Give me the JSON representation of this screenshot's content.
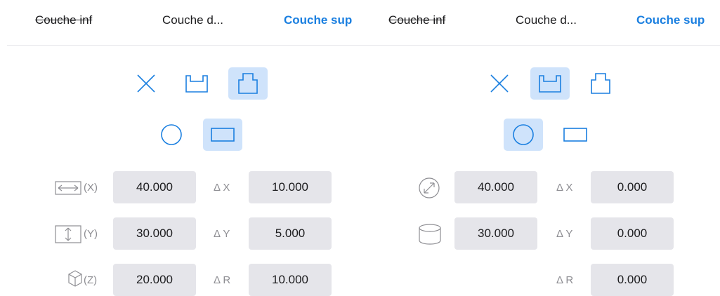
{
  "colors": {
    "accent": "#1a7fe0",
    "selected_bg": "#cfe3fb",
    "field_bg": "#e5e5ea",
    "muted": "#8e8e93"
  },
  "left": {
    "tabs": [
      {
        "label": "Couche inf",
        "state": "struck"
      },
      {
        "label": "Couche d...",
        "state": "normal"
      },
      {
        "label": "Couche sup",
        "state": "active"
      }
    ],
    "mode_buttons": [
      {
        "icon": "close-icon",
        "selected": false
      },
      {
        "icon": "pocket-down-icon",
        "selected": false
      },
      {
        "icon": "pocket-up-icon",
        "selected": true
      }
    ],
    "shape_buttons": [
      {
        "icon": "circle-icon",
        "selected": false
      },
      {
        "icon": "rectangle-icon",
        "selected": true
      }
    ],
    "rows": [
      {
        "icon": "width-icon",
        "axis": "(X)",
        "value": "40.000",
        "delta_label": "Δ X",
        "delta_value": "10.000"
      },
      {
        "icon": "height-icon",
        "axis": "(Y)",
        "value": "30.000",
        "delta_label": "Δ Y",
        "delta_value": "5.000"
      },
      {
        "icon": "depth-cube-icon",
        "axis": "(Z)",
        "value": "20.000",
        "delta_label": "Δ R",
        "delta_value": "10.000"
      }
    ]
  },
  "right": {
    "tabs": [
      {
        "label": "Couche inf",
        "state": "struck"
      },
      {
        "label": "Couche d...",
        "state": "normal"
      },
      {
        "label": "Couche sup",
        "state": "active"
      }
    ],
    "mode_buttons": [
      {
        "icon": "close-icon",
        "selected": false
      },
      {
        "icon": "pocket-down-icon",
        "selected": true
      },
      {
        "icon": "pocket-up-icon",
        "selected": false
      }
    ],
    "shape_buttons": [
      {
        "icon": "circle-icon",
        "selected": true
      },
      {
        "icon": "rectangle-icon",
        "selected": false
      }
    ],
    "rows": [
      {
        "icon": "diameter-icon",
        "value": "40.000",
        "delta_label": "Δ X",
        "delta_value": "0.000"
      },
      {
        "icon": "cylinder-icon",
        "value": "30.000",
        "delta_label": "Δ Y",
        "delta_value": "0.000"
      },
      {
        "delta_label": "Δ R",
        "delta_value": "0.000"
      }
    ]
  }
}
